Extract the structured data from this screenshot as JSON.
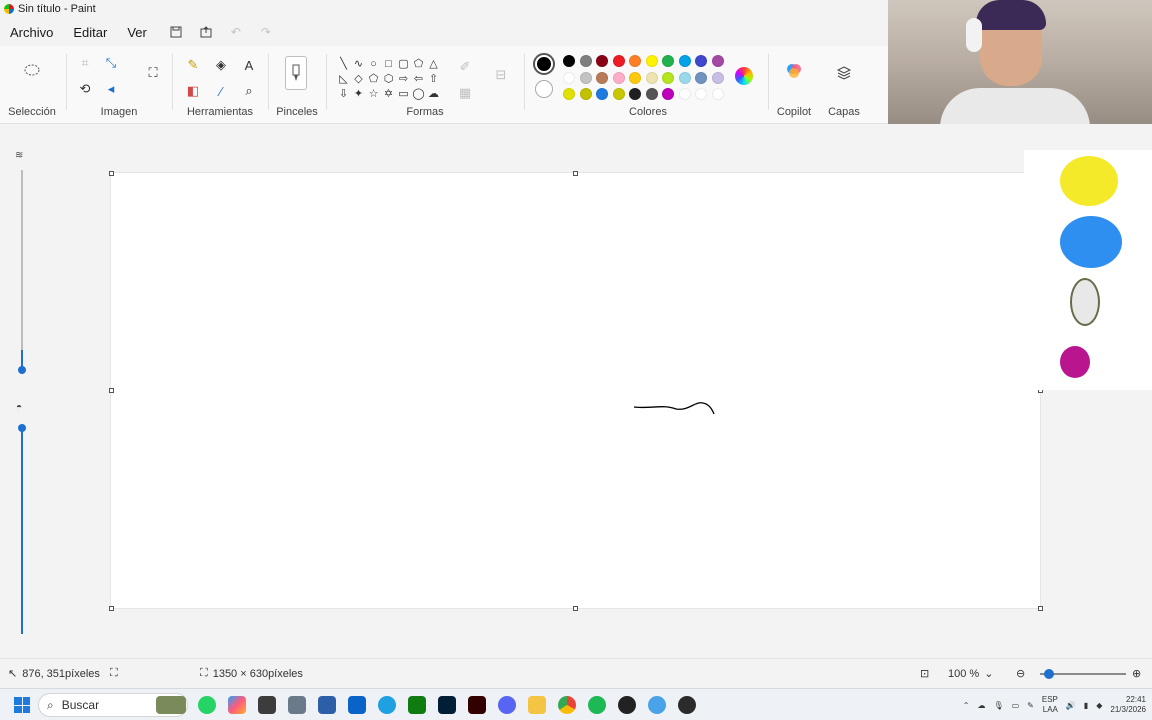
{
  "window": {
    "title": "Sin título - Paint"
  },
  "menu": {
    "items": [
      "Archivo",
      "Editar",
      "Ver"
    ]
  },
  "ribbon": {
    "groups": {
      "seleccion": "Selección",
      "imagen": "Imagen",
      "herramientas": "Herramientas",
      "pinceles": "Pinceles",
      "formas": "Formas",
      "colores": "Colores",
      "copilot": "Copilot",
      "capas": "Capas"
    }
  },
  "colors": {
    "primary": "#000000",
    "secondary": "#ffffff",
    "palette": [
      "#000000",
      "#7f7f7f",
      "#880015",
      "#ed1c24",
      "#ff7f27",
      "#fff200",
      "#22b14c",
      "#00a2e8",
      "#3f48cc",
      "#a349a4",
      "#ffffff",
      "#c3c3c3",
      "#b97a57",
      "#ffaec9",
      "#ffc90e",
      "#efe4b0",
      "#b5e61d",
      "#99d9ea",
      "#7092be",
      "#c8bfe7",
      "#e1e100",
      "#c2c200",
      "#1f7ae0",
      "#c8c800",
      "#202020",
      "#555555",
      "#bc00bc",
      "#ffffff",
      "#ffffff",
      "#ffffff"
    ]
  },
  "status": {
    "cursor": "876, 351píxeles",
    "canvas_size": "1350 × 630píxeles",
    "zoom": "100 %"
  },
  "taskbar": {
    "search_placeholder": "Buscar",
    "lang_top": "ESP",
    "lang_bottom": "LAA",
    "time": "22:41",
    "date": "21/3/2026"
  },
  "icons": {
    "selection": "lasso-icon",
    "brushes": "brush-icon",
    "copilot": "copilot-icon",
    "layers": "layers-icon"
  }
}
